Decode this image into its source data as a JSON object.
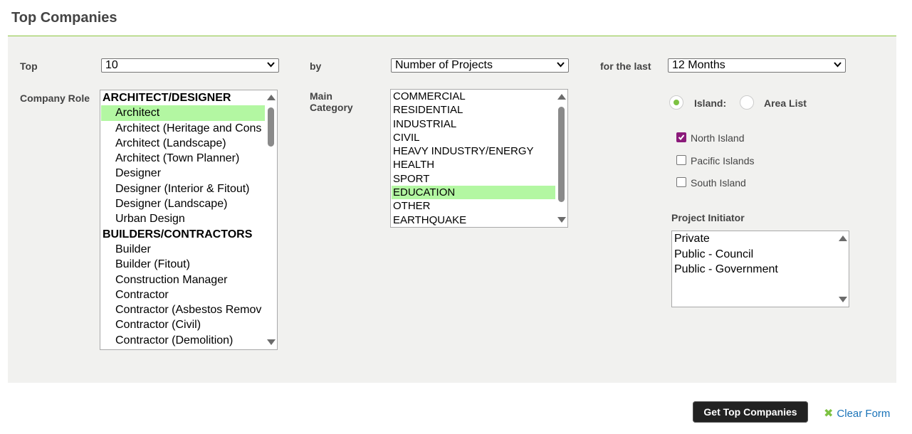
{
  "page": {
    "title": "Top Companies"
  },
  "filters": {
    "top_label": "Top",
    "top_value": "10",
    "by_label": "by",
    "by_value": "Number of Projects",
    "last_label": "for the last",
    "last_value": "12 Months"
  },
  "company_role": {
    "label": "Company Role",
    "options": [
      {
        "text": "ARCHITECT/DESIGNER",
        "group": true,
        "selected": false
      },
      {
        "text": "Architect",
        "group": false,
        "selected": true
      },
      {
        "text": "Architect (Heritage and Cons",
        "group": false,
        "selected": false
      },
      {
        "text": "Architect (Landscape)",
        "group": false,
        "selected": false
      },
      {
        "text": "Architect (Town Planner)",
        "group": false,
        "selected": false
      },
      {
        "text": "Designer",
        "group": false,
        "selected": false
      },
      {
        "text": "Designer (Interior & Fitout)",
        "group": false,
        "selected": false
      },
      {
        "text": "Designer (Landscape)",
        "group": false,
        "selected": false
      },
      {
        "text": "Urban Design",
        "group": false,
        "selected": false
      },
      {
        "text": "BUILDERS/CONTRACTORS",
        "group": true,
        "selected": false
      },
      {
        "text": "Builder",
        "group": false,
        "selected": false
      },
      {
        "text": "Builder (Fitout)",
        "group": false,
        "selected": false
      },
      {
        "text": "Construction Manager",
        "group": false,
        "selected": false
      },
      {
        "text": "Contractor",
        "group": false,
        "selected": false
      },
      {
        "text": "Contractor (Asbestos Remov",
        "group": false,
        "selected": false
      },
      {
        "text": "Contractor (Civil)",
        "group": false,
        "selected": false
      },
      {
        "text": "Contractor (Demolition)",
        "group": false,
        "selected": false
      }
    ]
  },
  "main_category": {
    "label_line1": "Main",
    "label_line2": "Category",
    "options": [
      {
        "text": "COMMERCIAL",
        "selected": false
      },
      {
        "text": "RESIDENTIAL",
        "selected": false
      },
      {
        "text": "INDUSTRIAL",
        "selected": false
      },
      {
        "text": "CIVIL",
        "selected": false
      },
      {
        "text": "HEAVY INDUSTRY/ENERGY",
        "selected": false
      },
      {
        "text": "HEALTH",
        "selected": false
      },
      {
        "text": "SPORT",
        "selected": false
      },
      {
        "text": "EDUCATION",
        "selected": true
      },
      {
        "text": "OTHER",
        "selected": false
      },
      {
        "text": "EARTHQUAKE",
        "selected": false
      }
    ]
  },
  "region": {
    "island_label": "Island:",
    "area_label": "Area List",
    "island_selected": true,
    "islands": [
      {
        "text": "North Island",
        "checked": true
      },
      {
        "text": "Pacific Islands",
        "checked": false
      },
      {
        "text": "South Island",
        "checked": false
      }
    ]
  },
  "project_initiator": {
    "label": "Project Initiator",
    "options": [
      "Private",
      "Public - Council",
      "Public - Government"
    ]
  },
  "actions": {
    "submit_label": "Get Top Companies",
    "clear_label": "Clear Form"
  },
  "colors": {
    "accent_green": "#7dc242",
    "selection": "#b3f7a2",
    "checkbox_checked": "#8b1a7a",
    "link": "#1a73b8"
  }
}
